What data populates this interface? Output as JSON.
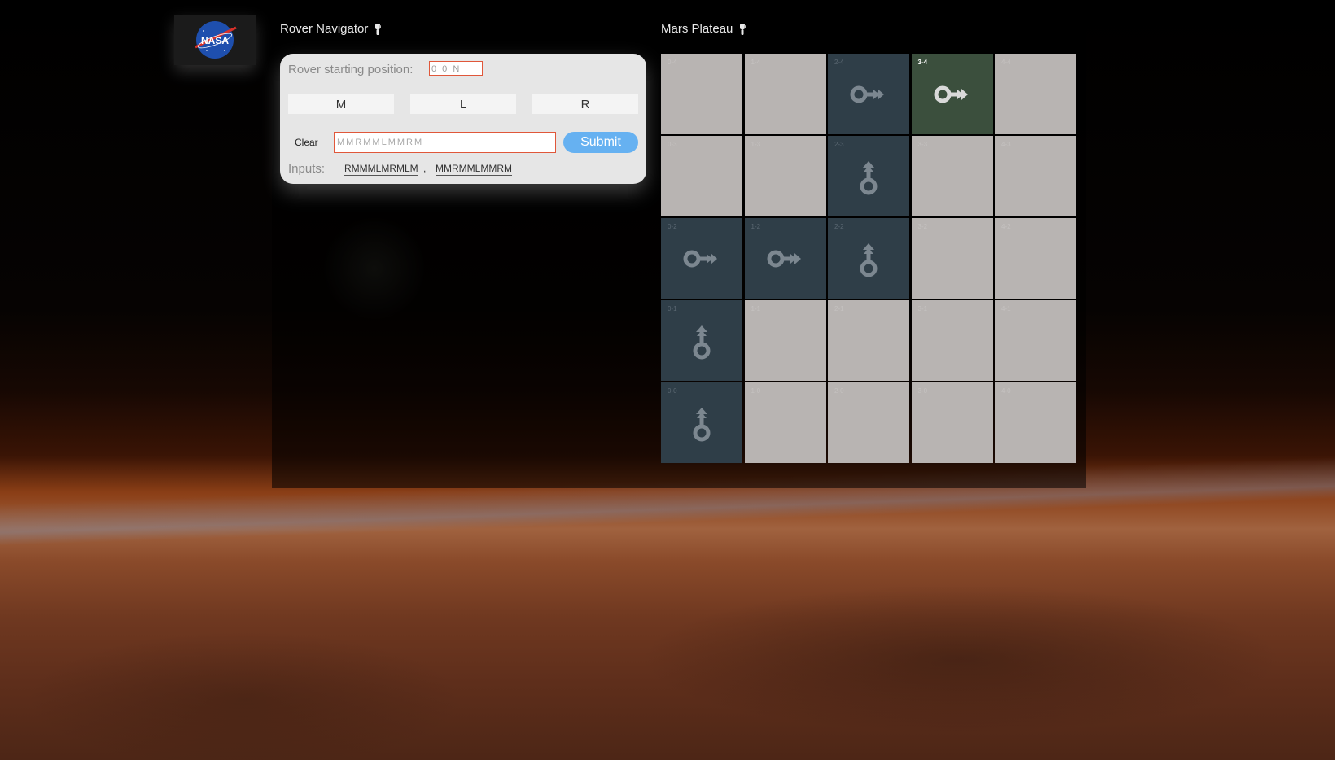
{
  "logo": {
    "text": "NASA"
  },
  "navigator": {
    "title": "Rover Navigator",
    "start_label": "Rover starting position:",
    "start_value": "0 0 N",
    "buttons": [
      "M",
      "L",
      "R"
    ],
    "clear_label": "Clear",
    "command_value": "MMRMMLMMRM",
    "submit_label": "Submit",
    "inputs_label": "Inputs:",
    "inputs": [
      "RMMMLMRMLM",
      "MMRMMLMMRM"
    ]
  },
  "plateau": {
    "title": "Mars Plateau",
    "rows": [
      [
        {
          "coord": "0-4",
          "state": "empty"
        },
        {
          "coord": "1-4",
          "state": "empty"
        },
        {
          "coord": "2-4",
          "state": "visited",
          "heading": "E"
        },
        {
          "coord": "3-4",
          "state": "current",
          "heading": "E"
        },
        {
          "coord": "4-4",
          "state": "empty"
        }
      ],
      [
        {
          "coord": "0-3",
          "state": "empty"
        },
        {
          "coord": "1-3",
          "state": "empty"
        },
        {
          "coord": "2-3",
          "state": "visited",
          "heading": "N"
        },
        {
          "coord": "3-3",
          "state": "empty"
        },
        {
          "coord": "4-3",
          "state": "empty"
        }
      ],
      [
        {
          "coord": "0-2",
          "state": "visited",
          "heading": "E"
        },
        {
          "coord": "1-2",
          "state": "visited",
          "heading": "E"
        },
        {
          "coord": "2-2",
          "state": "visited",
          "heading": "N"
        },
        {
          "coord": "3-2",
          "state": "empty"
        },
        {
          "coord": "4-2",
          "state": "empty"
        }
      ],
      [
        {
          "coord": "0-1",
          "state": "visited",
          "heading": "N"
        },
        {
          "coord": "1-1",
          "state": "empty"
        },
        {
          "coord": "2-1",
          "state": "empty"
        },
        {
          "coord": "3-1",
          "state": "empty"
        },
        {
          "coord": "4-1",
          "state": "empty"
        }
      ],
      [
        {
          "coord": "0-0",
          "state": "visited",
          "heading": "N"
        },
        {
          "coord": "1-0",
          "state": "empty"
        },
        {
          "coord": "2-0",
          "state": "empty"
        },
        {
          "coord": "3-0",
          "state": "empty"
        },
        {
          "coord": "4-0",
          "state": "empty"
        }
      ]
    ]
  },
  "colors": {
    "empty": "#b8b4b2",
    "visited": "#2f3e48",
    "current": "#3b4f3d",
    "accent": "#66b1f1",
    "error_border": "#e0573a"
  }
}
